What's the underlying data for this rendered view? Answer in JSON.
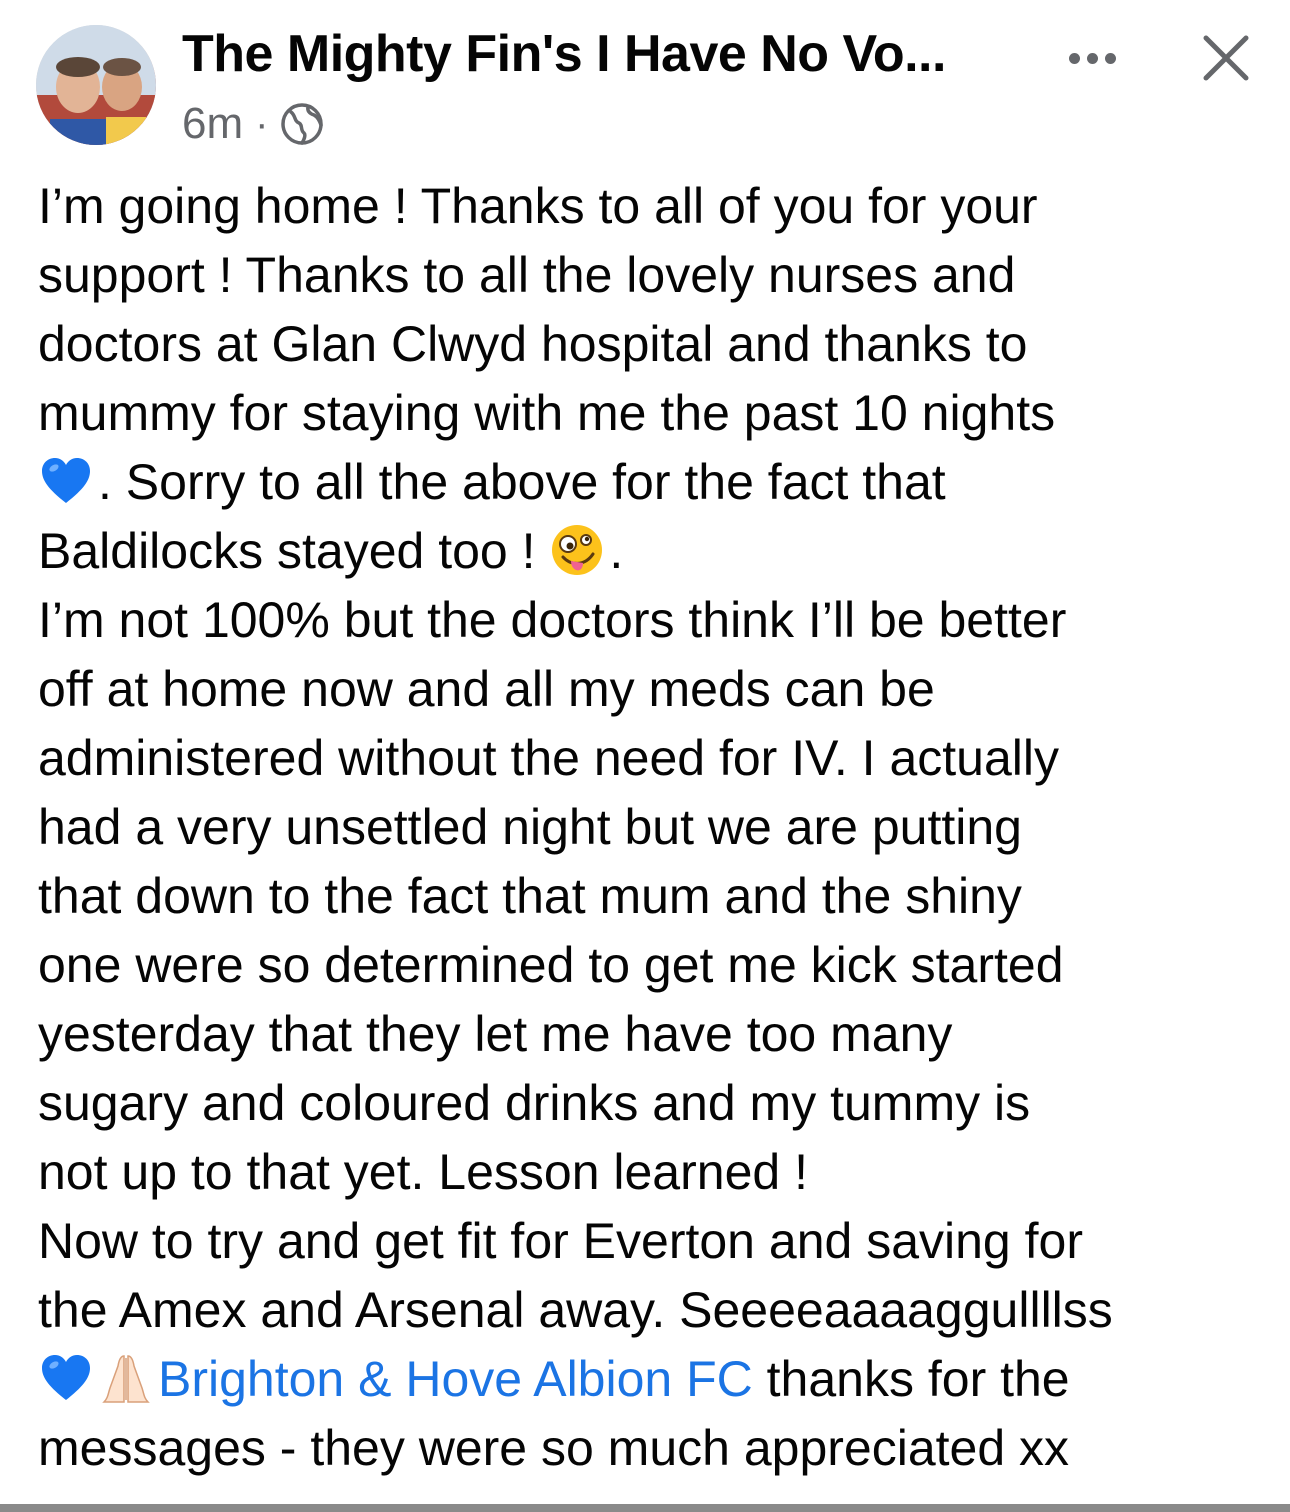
{
  "header": {
    "title": "The Mighty Fin's I Have No Vo...",
    "timestamp": "6m",
    "separator": "·",
    "privacy_icon": "globe-icon",
    "more_icon": "more-options-icon",
    "close_icon": "close-icon"
  },
  "post": {
    "lines": [
      "I’m going home ! Thanks to all of you for your",
      "support ! Thanks to all the lovely nurses and",
      "doctors at Glan Clwyd hospital and thanks to",
      "mummy for staying with me the past 10 nights",
      ". Sorry to all the above for the fact that",
      "Baldilocks stayed too ! ",
      ".",
      "I’m not 100% but the doctors think I’ll be better",
      "off at home now and all my meds can be",
      "administered without the need for IV. I actually",
      "had a very unsettled night but we are putting",
      "that down to the fact that mum and the shiny",
      "one were so determined to get me kick started",
      "yesterday that they let me have too many",
      "sugary and coloured drinks and my tummy is",
      "not up to that yet. Lesson learned !",
      "Now to try and get fit for Everton and saving for",
      "the Amex and Arsenal away. Seeeeaaaaggullllss",
      " thanks for the",
      "messages - they were so much appreciated xx"
    ],
    "mention": "Brighton & Hove Albion FC",
    "emojis": [
      "blue-heart-emoji",
      "zany-face-emoji",
      "blue-heart-emoji",
      "folded-hands-emoji"
    ],
    "colors": {
      "text": "#050505",
      "mention": "#1b74e4",
      "meta": "#65676b"
    }
  }
}
